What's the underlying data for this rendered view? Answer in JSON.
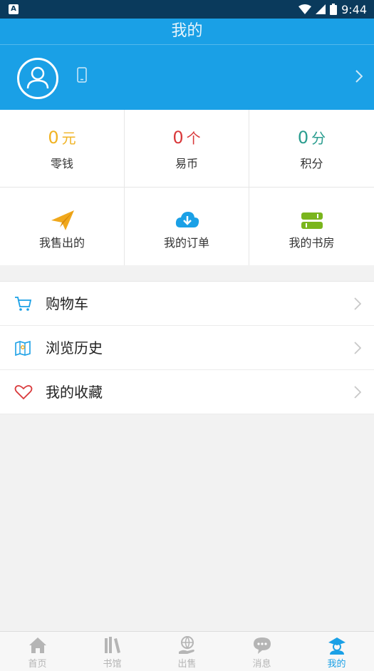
{
  "status_bar": {
    "time": "9:44"
  },
  "header": {
    "title": "我的"
  },
  "stats": [
    {
      "value": "0",
      "unit": "元",
      "label": "零钱",
      "color": "#f0b323"
    },
    {
      "value": "0",
      "unit": "个",
      "label": "易币",
      "color": "#d9393b"
    },
    {
      "value": "0",
      "unit": "分",
      "label": "积分",
      "color": "#2a9d8f"
    }
  ],
  "actions": [
    {
      "label": "我售出的",
      "icon": "paper-plane-icon",
      "color": "#f0a81c"
    },
    {
      "label": "我的订单",
      "icon": "cloud-download-icon",
      "color": "#1aa0e6"
    },
    {
      "label": "我的书房",
      "icon": "books-icon",
      "color": "#7ab51d"
    }
  ],
  "menu": [
    {
      "label": "购物车",
      "icon": "cart-icon"
    },
    {
      "label": "浏览历史",
      "icon": "map-icon"
    },
    {
      "label": "我的收藏",
      "icon": "heart-icon"
    }
  ],
  "tabs": [
    {
      "label": "首页",
      "icon": "home-icon"
    },
    {
      "label": "书馆",
      "icon": "library-icon"
    },
    {
      "label": "出售",
      "icon": "sell-icon"
    },
    {
      "label": "消息",
      "icon": "message-icon"
    },
    {
      "label": "我的",
      "icon": "profile-icon",
      "active": true
    }
  ],
  "colors": {
    "primary": "#1aa0e6",
    "tab_inactive": "#b5b5b5"
  }
}
